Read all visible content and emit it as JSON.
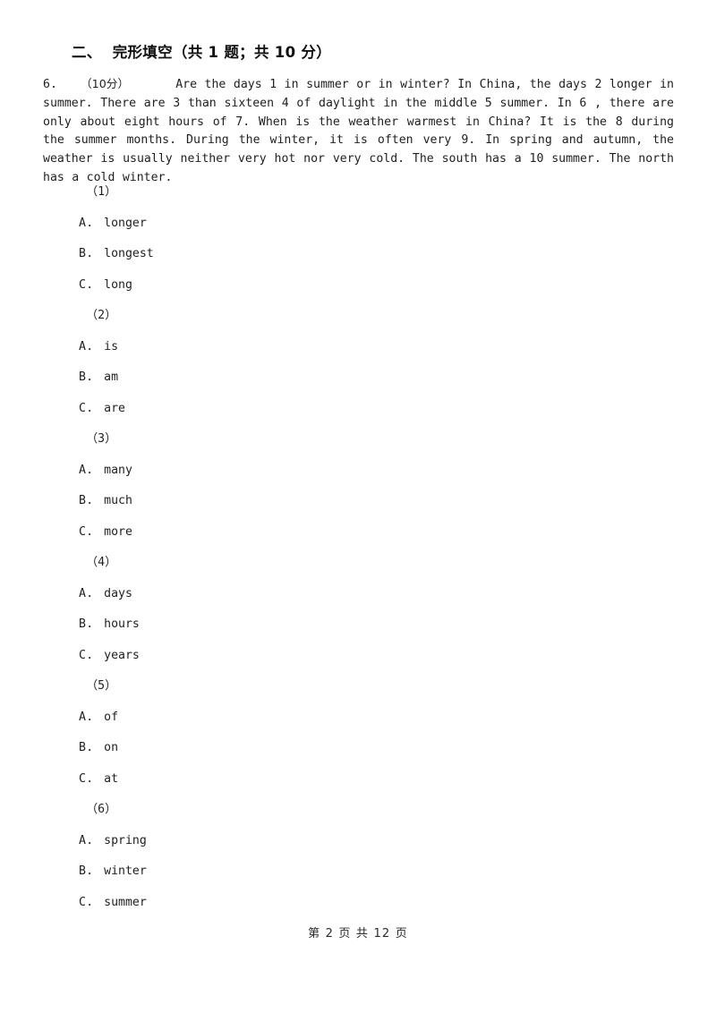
{
  "section": {
    "heading": "二、  完形填空（共 1 题；共 10 分）"
  },
  "passage": {
    "question_number": "6.",
    "score": "（10分）",
    "text": "Are the days 1 in summer or in winter? In China, the days 2 longer in summer. There are 3 than sixteen  4 of daylight in the middle  5  summer. In  6 , there are only about eight hours of  7.  When is the weather warmest in China? It is the  8 during the summer months. During the winter, it is often very 9.  In spring and autumn, the weather is usually neither very hot nor very cold. The south has a  10 summer. The north has a cold winter."
  },
  "questions": [
    {
      "label": "（1）",
      "options": [
        {
          "letter": "A",
          "sep": "．",
          "text": "longer"
        },
        {
          "letter": "B",
          "sep": "．",
          "text": "longest"
        },
        {
          "letter": "C",
          "sep": "．",
          "text": "long"
        }
      ]
    },
    {
      "label": "（2）",
      "options": [
        {
          "letter": "A",
          "sep": "．",
          "text": "is"
        },
        {
          "letter": "B",
          "sep": "．",
          "text": "am"
        },
        {
          "letter": "C",
          "sep": "．",
          "text": "are"
        }
      ]
    },
    {
      "label": "（3）",
      "options": [
        {
          "letter": "A",
          "sep": "．",
          "text": "many"
        },
        {
          "letter": "B",
          "sep": "．",
          "text": "much"
        },
        {
          "letter": "C",
          "sep": "．",
          "text": "more"
        }
      ]
    },
    {
      "label": "（4）",
      "options": [
        {
          "letter": "A",
          "sep": "．",
          "text": "days"
        },
        {
          "letter": "B",
          "sep": "．",
          "text": "hours"
        },
        {
          "letter": "C",
          "sep": "．",
          "text": "years"
        }
      ]
    },
    {
      "label": "（5）",
      "options": [
        {
          "letter": "A",
          "sep": "．",
          "text": "of"
        },
        {
          "letter": "B",
          "sep": "．",
          "text": "on"
        },
        {
          "letter": "C",
          "sep": "．",
          "text": "at"
        }
      ]
    },
    {
      "label": "（6）",
      "options": [
        {
          "letter": "A",
          "sep": "．",
          "text": "spring"
        },
        {
          "letter": "B",
          "sep": "．",
          "text": "winter"
        },
        {
          "letter": "C",
          "sep": "．",
          "text": "summer"
        }
      ]
    }
  ],
  "footer": {
    "text": "第 2 页 共 12 页"
  }
}
